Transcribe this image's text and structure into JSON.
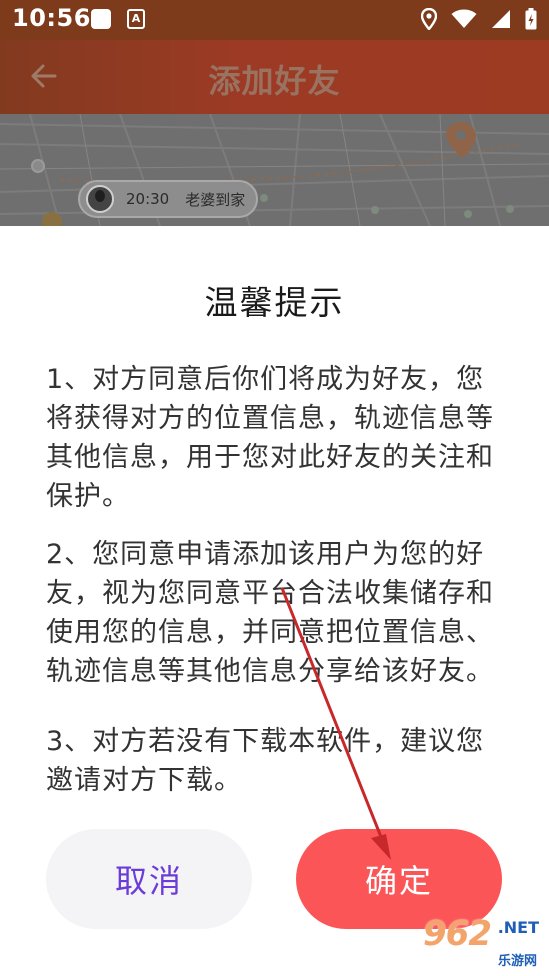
{
  "status_bar": {
    "time": "10:56",
    "a_badge": "A",
    "icons": [
      "square-notification-icon",
      "a-notification-icon",
      "location-icon",
      "wifi-icon",
      "signal-icon",
      "battery-icon"
    ]
  },
  "app_bar": {
    "title": "添加好友",
    "back_icon": "arrow-left-icon"
  },
  "map_preview": {
    "friend_chip": {
      "time": "20:30",
      "label": "老婆到家"
    }
  },
  "dialog": {
    "title": "温馨提示",
    "paragraphs": [
      "1、对方同意后你们将成为好友，您将获得对方的位置信息，轨迹信息等其他信息，用于您对此好友的关注和保护。",
      "2、您同意申请添加该用户为您的好友，视为您同意平台合法收集储存和使用您的信息，并同意把位置信息、轨迹信息等其他信息分享给该好友。",
      "3、对方若没有下载本软件，建议您邀请对方下载。"
    ],
    "cancel_label": "取消",
    "confirm_label": "确定"
  },
  "watermark": {
    "main": "962",
    "net": ".NET",
    "sub": "乐游网"
  },
  "colors": {
    "app_bar": "#9d3a25",
    "status_bar": "#7e3b1c",
    "confirm": "#fc5557",
    "cancel_text": "#6a3cd8",
    "arrow": "#e5262b"
  }
}
